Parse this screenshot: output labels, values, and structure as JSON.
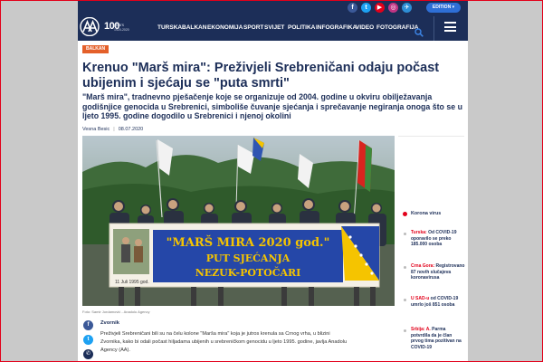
{
  "topbar": {
    "social": [
      {
        "glyph": "f",
        "color": "#3b5998"
      },
      {
        "glyph": "t",
        "color": "#1da1f2"
      },
      {
        "glyph": "▶",
        "color": "#e2001a"
      },
      {
        "glyph": "◎",
        "color": "#c13584"
      },
      {
        "glyph": "✈",
        "color": "#2e8fd6"
      }
    ],
    "edition_label": "EDITION ▾"
  },
  "header": {
    "logo_number": "100",
    "logo_years": "years",
    "logo_dates": "1920-2020",
    "nav": [
      "TURSKA",
      "BALKAN",
      "EKONOMIJA",
      "SPORT",
      "SVIJET",
      "POLITIKA",
      "INFOGRAFIKA",
      "VIDEO",
      "FOTOGRAFIJA"
    ]
  },
  "article": {
    "category": "BALKAN",
    "headline": "Krenuo \"Marš mira\": Preživjeli Srebreničani odaju počast ubijenim i sjećaju se \"puta smrti\"",
    "lead": "\"Marš mira\", tradnevno pješačenje koje se organizuje od 2004. godine u okviru obilježavanja godišnjice genocida u Srebrenici, simboliše čuvanje sjećanja i sprečavanje negiranja onoga što se u ljeto 1995. godine dogodilo u Srebrenici i njenoj okolini",
    "author": "Vesna Besic",
    "date": "08.07.2020",
    "photo": {
      "banner_line1": "\"MARŠ MIRA 2020 god.\"",
      "banner_line2": "PUT SJEĆANJA",
      "banner_line3": "NEZUK-POTOČARI",
      "inset_text": "11 Juli 1995 god."
    },
    "caption": "Foto: Samir Jordamović - Anadolu Agency",
    "dateline": "Zvornik",
    "body": "Preživjeli Srebreničani bili su na čelu kolone \"Marša mira\" koja je jutros krenula sa Crnog vrha, u blizini Zvornika, kako bi odali počast hiljadama ubijenih u srebreničkom genocidu u ljeto 1995. godine, javlja Anadolu Agency (AA)."
  },
  "share": [
    {
      "glyph": "f",
      "color": "#3b5998"
    },
    {
      "glyph": "t",
      "color": "#1da1f2"
    },
    {
      "glyph": "✆",
      "color": "#1c2e58"
    }
  ],
  "sidebar": {
    "title": "Korona virus",
    "items": [
      {
        "highlight": "Turska:",
        "text": " Od COVID-19 oporavilo se preko 185.000 osoba"
      },
      {
        "highlight": "Crna Gora:",
        "text": " Registrovano 87 novih slučajeva koronavirusa"
      },
      {
        "highlight": "U SAD-u",
        "text": " od COVID-19 umrlo još 851 osoba"
      },
      {
        "highlight": "Srbija: A.",
        "text": " Parma potvrdila da je član prvog tima pozitivan na COVID-19"
      }
    ]
  }
}
